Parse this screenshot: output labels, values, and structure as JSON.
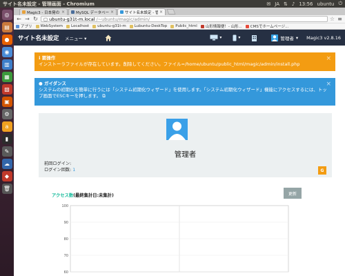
{
  "os": {
    "window_title": "サイト名未設定 - 管理画面 - Chromium",
    "keyboard": "JA",
    "time": "13:56",
    "user": "ubuntu"
  },
  "launcher": {
    "icons": [
      "dash-icon",
      "files-icon",
      "firefox-icon",
      "chromium-icon",
      "libreoffice-writer-icon",
      "libreoffice-calc-icon",
      "libreoffice-impress-icon",
      "software-center-icon",
      "settings-icon",
      "amazon-icon",
      "terminal-icon",
      "editor-icon",
      "ubuntu-one-icon",
      "app-icon",
      "trash-icon"
    ]
  },
  "browser": {
    "tabs": [
      {
        "label": "Magic3 - 日本発のオーギ",
        "active": false
      },
      {
        "label": "MySQL データベース サー",
        "active": false
      },
      {
        "label": "サイト名未設定 - 管理画面",
        "active": true
      }
    ],
    "url_host": "ubuntu-g31t-m.local",
    "url_path": "/~ubuntu/magic/admin/",
    "bookmarks": [
      "アプリ",
      "WebSystem",
      "Localhost",
      "ubuntu-g31t-m",
      "Lubuntu-DeskTop",
      "Public_html",
      "山形情報便！- 山形...",
      "CMSでホームページ..."
    ]
  },
  "site": {
    "title": "サイト名未設定",
    "menu_label": "メニュー",
    "admin_label": "管理者",
    "version": "Magic3 v2.8.16"
  },
  "alerts": {
    "warning_head": "要操作",
    "warning_text": "インストーラファイルが存在しています。削除してください。ファイル=/home/ubuntu/public_html/magic/admin/install.php",
    "info_head": "ガイダンス",
    "info_text": "システムの初期化を簡単に行うには「システム初期化ウィザード」を使用します。「システム初期化ウィザード」機能にアクセスするには、トップ画面でESCキーを押します。",
    "close_glyph": "×"
  },
  "profile": {
    "name": "管理者",
    "last_login_label": "前回ログイン:",
    "login_count_label": "ログイン回数:",
    "login_count": "1",
    "g_button": "G"
  },
  "access": {
    "title_green": "アクセス数",
    "title_rest": "(最終集計日:未集計)",
    "update_label": "更新"
  },
  "chart_data": {
    "type": "line",
    "title": "アクセス数(最終集計日:未集計)",
    "series": [],
    "ylim": [
      0,
      100
    ],
    "y_ticks": [
      "100",
      "90",
      "80",
      "70",
      "60"
    ],
    "grid": true
  },
  "colors": {
    "header_bg": "#263043",
    "warning": "#f39c12",
    "info": "#3498db",
    "panel_bg": "#ecf0f1",
    "accent_green": "#18bc9c"
  }
}
